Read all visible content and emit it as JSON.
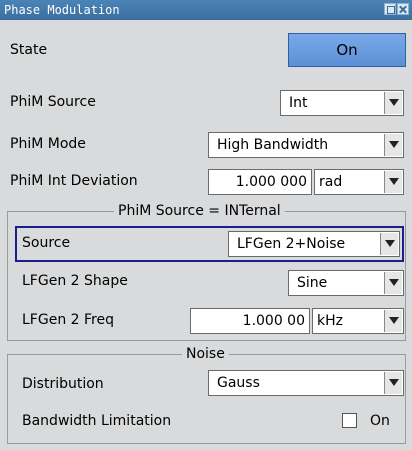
{
  "window": {
    "title": "Phase Modulation"
  },
  "state": {
    "label": "State",
    "value": "On"
  },
  "phim_source": {
    "label": "PhiM Source",
    "value": "Int"
  },
  "phim_mode": {
    "label": "PhiM Mode",
    "value": "High Bandwidth"
  },
  "phim_int_deviation": {
    "label": "PhiM Int Deviation",
    "value": "1.000 000",
    "unit": "rad"
  },
  "internal_panel": {
    "title": "PhiM Source = INTernal",
    "source": {
      "label": "Source",
      "value": "LFGen 2+Noise"
    },
    "lfgen2_shape": {
      "label": "LFGen 2 Shape",
      "value": "Sine"
    },
    "lfgen2_freq": {
      "label": "LFGen 2 Freq",
      "value": "1.000 00",
      "unit": "kHz"
    }
  },
  "noise_panel": {
    "title": "Noise",
    "distribution": {
      "label": "Distribution",
      "value": "Gauss"
    },
    "bandwidth_limitation": {
      "label": "Bandwidth Limitation",
      "checkbox_label": "On",
      "checked": false
    }
  }
}
